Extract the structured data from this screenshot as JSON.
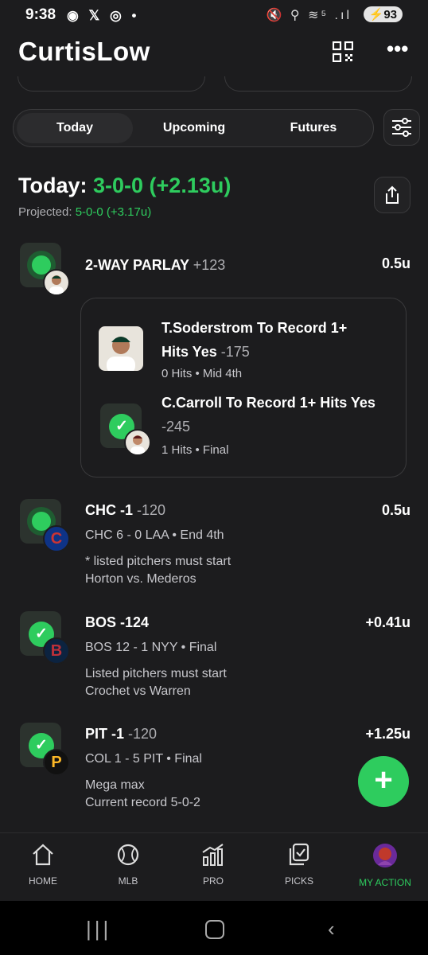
{
  "status_bar": {
    "time": "9:38",
    "left_icons": "◉ 𝕏 ◎ •",
    "right_icons": "🔇 ⚲ ≋⁵ .ıl",
    "battery": "93"
  },
  "header": {
    "title": "CurtisLow"
  },
  "tabs": [
    {
      "label": "Today"
    },
    {
      "label": "Upcoming"
    },
    {
      "label": "Futures"
    }
  ],
  "summary": {
    "label": "Today:",
    "record": "3-0-0 (+2.13u)",
    "projected_label": "Projected:",
    "projected_value": "5-0-0 (+3.17u)"
  },
  "picks": [
    {
      "title": "2-WAY PARLAY",
      "odds": "+123",
      "units": "0.5u",
      "status": "live",
      "legs": [
        {
          "title": "T.Soderstrom To Record 1+ Hits Yes",
          "odds": "-175",
          "sub": "0 Hits • Mid 4th",
          "status": "live"
        },
        {
          "title": "C.Carroll To Record 1+ Hits Yes",
          "odds": "-245",
          "sub": "1 Hits • Final",
          "status": "won"
        }
      ]
    },
    {
      "title": "CHC -1",
      "odds": "-120",
      "units": "0.5u",
      "score": "CHC 6 - 0 LAA • End 4th",
      "note1": "* listed pitchers must start",
      "note2": "Horton vs. Mederos",
      "status": "live",
      "team_letter": "C"
    },
    {
      "title": "BOS -124",
      "odds": "",
      "units": "+0.41u",
      "score": "BOS 12 - 1 NYY • Final",
      "note1": "Listed pitchers must start",
      "note2": "Crochet vs Warren",
      "status": "won",
      "team_letter": "B"
    },
    {
      "title": "PIT -1",
      "odds": "-120",
      "units": "+1.25u",
      "score": "COL 1 - 5 PIT • Final",
      "note1": "Mega max",
      "note2": "Current record 5-0-2",
      "status": "won",
      "team_letter": "P"
    }
  ],
  "nav": [
    {
      "label": "HOME",
      "icon": "home-icon"
    },
    {
      "label": "MLB",
      "icon": "baseball-icon"
    },
    {
      "label": "PRO",
      "icon": "pro-chart-icon"
    },
    {
      "label": "PICKS",
      "icon": "picks-icon"
    },
    {
      "label": "MY ACTION",
      "icon": "avatar-icon"
    }
  ],
  "colors": {
    "accent": "#2ecc5e",
    "background": "#1c1c1e",
    "surface": "#2c2c2e"
  }
}
